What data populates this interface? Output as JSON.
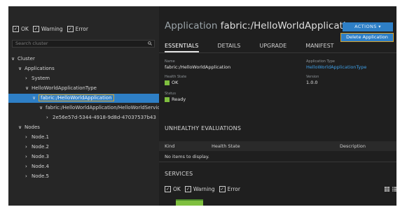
{
  "filters": {
    "ok": "OK",
    "warning": "Warning",
    "error": "Error",
    "check": "✓"
  },
  "search": {
    "placeholder": "Search cluster"
  },
  "tree": {
    "cluster": "Cluster",
    "applications": "Applications",
    "system": "System",
    "app_type": "HelloWorldApplicationType",
    "app": "fabric:/HelloWorldApplication",
    "service": "fabric:/HelloWorldApplication/HelloWorldService",
    "partition": "2e56e57d-5344-4918-9d8d-47037537b43",
    "nodes": "Nodes",
    "node_items": [
      "Node.1",
      "Node.2",
      "Node.3",
      "Node.4",
      "Node.5"
    ]
  },
  "header": {
    "kind": "Application",
    "name": "fabric:/HelloWorldApplication"
  },
  "actions": {
    "label": "ACTIONS ▾",
    "delete": "Delete Application"
  },
  "tabs": [
    "ESSENTIALS",
    "DETAILS",
    "UPGRADE",
    "MANIFEST"
  ],
  "essentials": {
    "name_label": "Name",
    "name_value": "fabric:/HelloWorldApplication",
    "type_label": "Application Type",
    "type_value": "HelloWorldApplicationType",
    "health_label": "Health State",
    "health_value": "OK",
    "version_label": "Version",
    "version_value": "1.0.0",
    "status_label": "Status",
    "status_value": "Ready"
  },
  "unhealthy": {
    "title": "UNHEALTHY EVALUATIONS",
    "columns": [
      "Kind",
      "Health State",
      "Description"
    ],
    "empty": "No items to display."
  },
  "services": {
    "title": "SERVICES",
    "ok": "OK",
    "warning": "Warning",
    "error": "Error"
  },
  "colors": {
    "accent": "#2e7fc6",
    "highlight": "#d8a22a",
    "ok": "#7fbf3f",
    "background": "#1f1f1f"
  }
}
